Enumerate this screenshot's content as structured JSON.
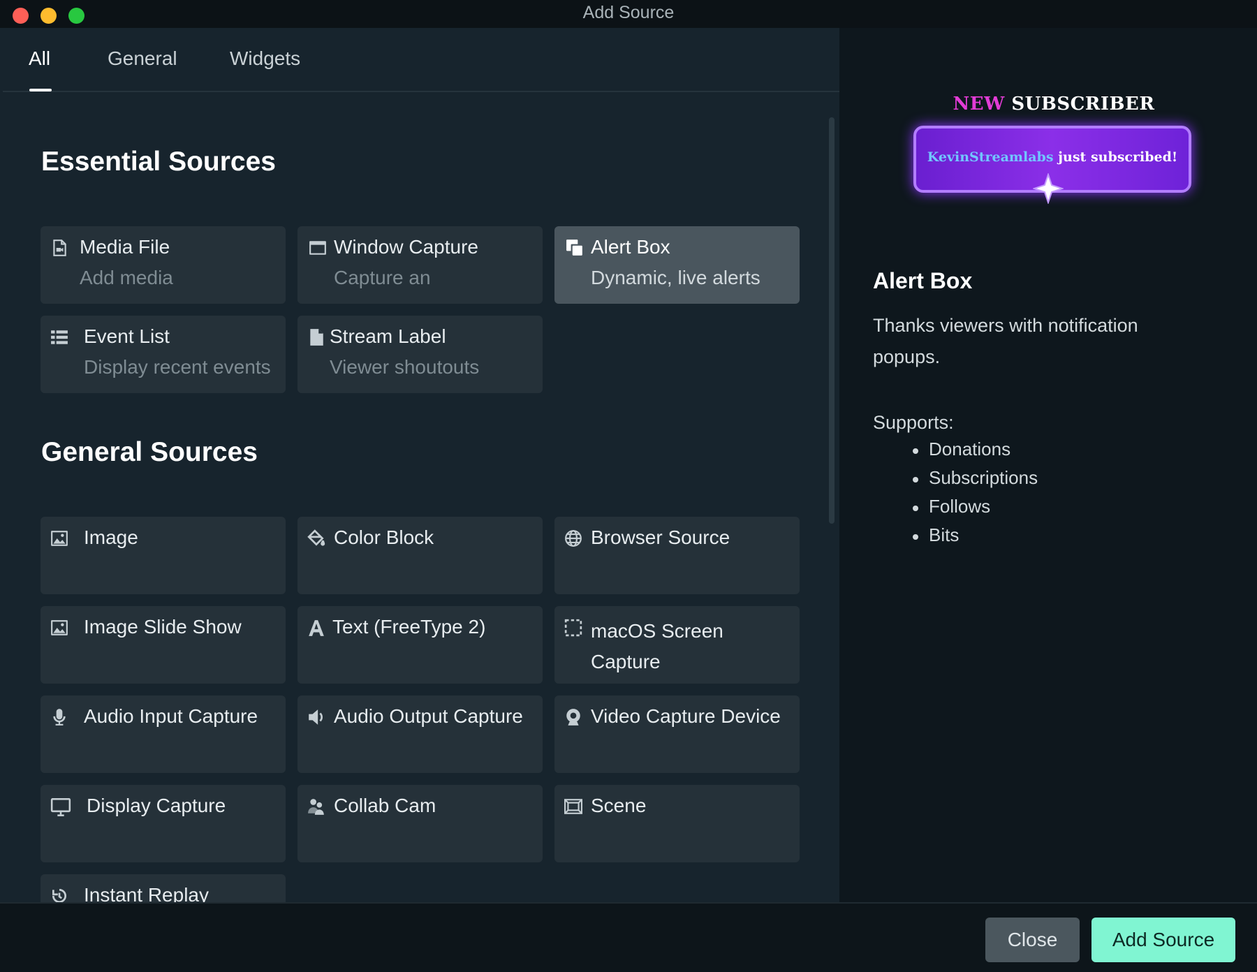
{
  "window": {
    "title": "Add Source"
  },
  "tabs": [
    {
      "label": "All",
      "active": true
    },
    {
      "label": "General",
      "active": false
    },
    {
      "label": "Widgets",
      "active": false
    }
  ],
  "essential": {
    "heading": "Essential Sources",
    "items": [
      {
        "title": "Media File",
        "desc": "Add media",
        "icon": "file-video-icon"
      },
      {
        "title": "Window Capture",
        "desc": "Capture an",
        "icon": "window-icon"
      },
      {
        "title": "Alert Box",
        "desc": "Dynamic, live alerts",
        "icon": "alert-box-icon",
        "selected": true
      },
      {
        "title": "Event List",
        "desc": "Display recent events",
        "icon": "list-icon"
      },
      {
        "title": "Stream Label",
        "desc": "Viewer shoutouts",
        "icon": "file-icon"
      }
    ]
  },
  "general": {
    "heading": "General Sources",
    "items": [
      {
        "title": "Image",
        "icon": "image-icon"
      },
      {
        "title": "Color Block",
        "icon": "paint-bucket-icon"
      },
      {
        "title": "Browser Source",
        "icon": "globe-icon"
      },
      {
        "title": "Image Slide Show",
        "icon": "image-icon"
      },
      {
        "title": "Text (FreeType 2)",
        "icon": "text-icon"
      },
      {
        "title_line1": "macOS Screen",
        "title_line2": "Capture",
        "icon": "screen-select-icon"
      },
      {
        "title": "Audio Input Capture",
        "icon": "microphone-icon"
      },
      {
        "title": "Audio Output Capture",
        "icon": "speaker-icon"
      },
      {
        "title": "Video Capture Device",
        "icon": "webcam-icon"
      },
      {
        "title": "Display Capture",
        "icon": "monitor-icon"
      },
      {
        "title": "Collab Cam",
        "icon": "users-icon"
      },
      {
        "title": "Scene",
        "icon": "scene-icon"
      },
      {
        "title": "Instant Replay",
        "icon": "replay-icon"
      }
    ]
  },
  "detail": {
    "preview": {
      "new_word": "NEW",
      "subscriber_word": "SUBSCRIBER",
      "name": "KevinStreamlabs",
      "message": " just subscribed!"
    },
    "title": "Alert Box",
    "description": "Thanks viewers with notification popups.",
    "supports_label": "Supports:",
    "supports": [
      "Donations",
      "Subscriptions",
      "Follows",
      "Bits"
    ]
  },
  "footer": {
    "close_label": "Close",
    "add_label": "Add Source"
  },
  "colors": {
    "accent": "#80f5d2",
    "selected_card": "#4a565e",
    "card": "#253139",
    "background": "#17242d"
  }
}
